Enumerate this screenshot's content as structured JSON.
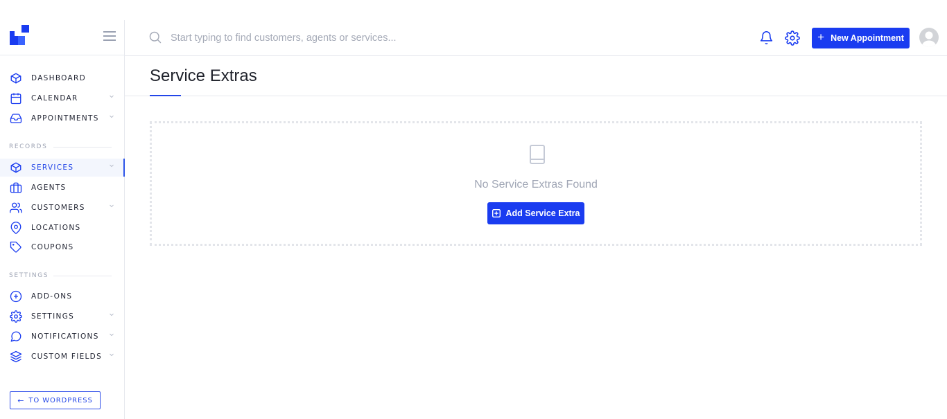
{
  "app": {
    "brand_color": "#1a3cf0"
  },
  "search": {
    "placeholder": "Start typing to find customers, agents or services..."
  },
  "topbar": {
    "new_appointment_label": "New Appointment"
  },
  "sidebar": {
    "main_items": [
      {
        "label": "DASHBOARD",
        "icon": "box-icon",
        "has_submenu": false
      },
      {
        "label": "CALENDAR",
        "icon": "calendar-icon",
        "has_submenu": true
      },
      {
        "label": "APPOINTMENTS",
        "icon": "inbox-icon",
        "has_submenu": true
      }
    ],
    "records_heading": "RECORDS",
    "records_items": [
      {
        "label": "SERVICES",
        "icon": "box-icon",
        "has_submenu": true,
        "active": true
      },
      {
        "label": "AGENTS",
        "icon": "briefcase-icon",
        "has_submenu": false
      },
      {
        "label": "CUSTOMERS",
        "icon": "users-icon",
        "has_submenu": true
      },
      {
        "label": "LOCATIONS",
        "icon": "map-pin-icon",
        "has_submenu": false
      },
      {
        "label": "COUPONS",
        "icon": "tag-icon",
        "has_submenu": false
      }
    ],
    "settings_heading": "SETTINGS",
    "settings_items": [
      {
        "label": "ADD-ONS",
        "icon": "plus-circle-icon",
        "has_submenu": false
      },
      {
        "label": "SETTINGS",
        "icon": "gear-icon",
        "has_submenu": true
      },
      {
        "label": "NOTIFICATIONS",
        "icon": "message-icon",
        "has_submenu": true
      },
      {
        "label": "CUSTOM FIELDS",
        "icon": "layers-icon",
        "has_submenu": true
      }
    ],
    "wordpress_button": "TO WORDPRESS"
  },
  "page": {
    "title": "Service Extras",
    "empty_message": "No Service Extras Found",
    "add_button_label": "Add Service Extra"
  }
}
